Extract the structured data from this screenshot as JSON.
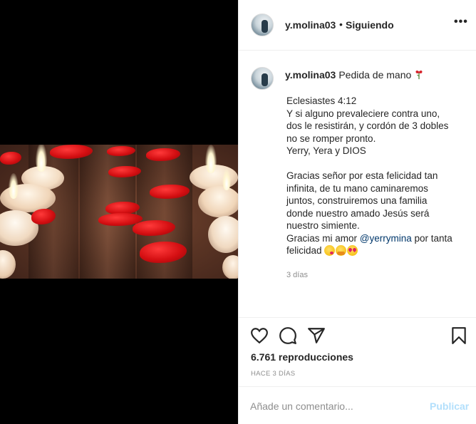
{
  "post": {
    "username": "y.molina03",
    "follow_status": "Siguiendo",
    "more_label": "•••",
    "caption_title": "Pedida de mano",
    "caption_title_emoji": "wilted-rose-icon",
    "caption_lines": [
      "Eclesiastes 4:12",
      "Y si alguno prevaleciere contra uno,",
      "dos le resistirán, y cordón de 3 dobles",
      "no se romper pronto.",
      "Yerry, Yera y DIOS",
      "",
      "Gracias señor por esta felicidad tan",
      "infinita, de tu mano caminaremos",
      "juntos, construiremos una familia",
      "donde nuestro amado Jesús será",
      "nuestro simiente."
    ],
    "thanks_prefix": "Gracias mi amor ",
    "mention": "@yerrymina",
    "thanks_suffix": " por tanta",
    "thanks_last": "felicidad ",
    "caption_emojis": [
      "face-blowing-kiss-icon",
      "hugging-face-icon",
      "heart-eyes-icon"
    ],
    "caption_time": "3 días",
    "views": "6.761 reproducciones",
    "posted_ago": "HACE 3 DÍAS"
  },
  "comment": {
    "placeholder": "Añade un comentario...",
    "publish_label": "Publicar"
  },
  "colors": {
    "link": "#00376b",
    "publish_disabled": "#b2dffc",
    "secondary_text": "#8e8e8e"
  }
}
